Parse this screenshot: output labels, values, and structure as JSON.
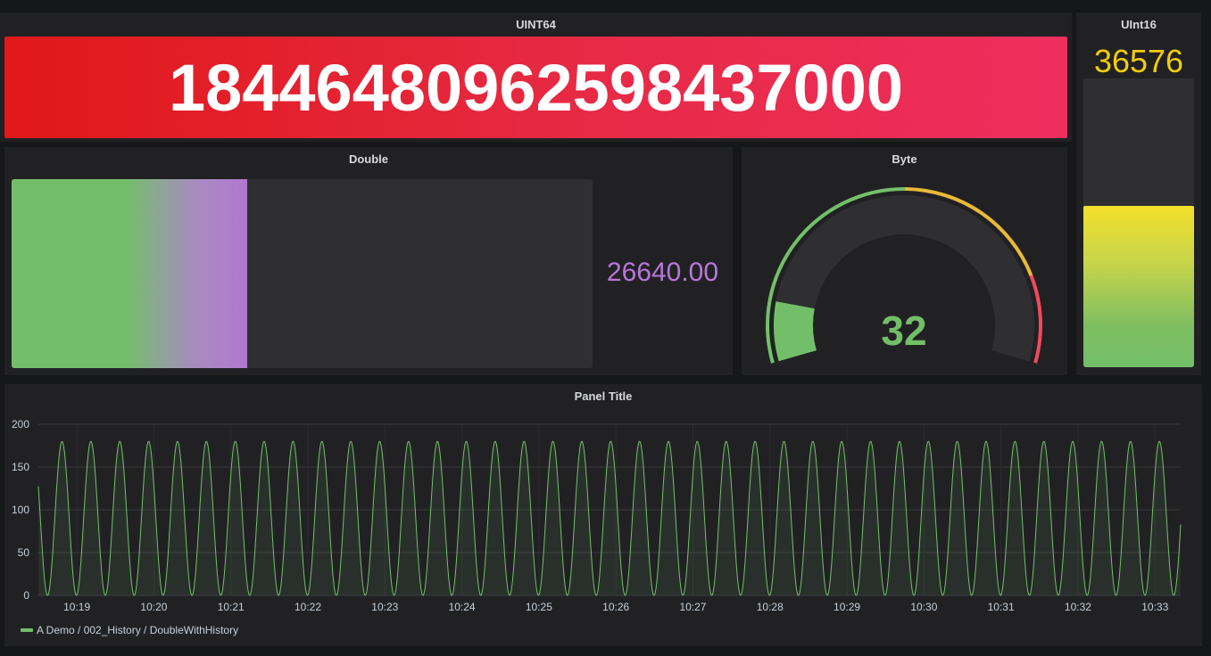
{
  "panels": {
    "uint64": {
      "title": "UINT64",
      "value": "18446480962598437000"
    },
    "uint16": {
      "title": "UInt16",
      "value": "36576",
      "value_color": "#f2cc0c",
      "fill_fraction": 0.56
    },
    "double": {
      "title": "Double",
      "value": "26640.00",
      "value_color": "#b877d9",
      "fill_fraction": 0.406
    },
    "byte": {
      "title": "Byte",
      "value": "32",
      "value_color": "#73bf69",
      "min": 0,
      "max": 255,
      "thresholds": [
        {
          "from": 0,
          "to": 128,
          "color": "#73bf69"
        },
        {
          "from": 128,
          "to": 210,
          "color": "#eab839"
        },
        {
          "from": 210,
          "to": 255,
          "color": "#f2495c"
        }
      ]
    },
    "timeseries": {
      "title": "Panel Title",
      "legend": "A Demo / 002_History / DoubleWithHistory"
    }
  },
  "chart_data": {
    "type": "line",
    "title": "Panel Title",
    "xlabel": "",
    "ylabel": "",
    "ylim": [
      0,
      200
    ],
    "y_ticks": [
      0,
      50,
      100,
      150,
      200
    ],
    "x_ticks": [
      "10:19",
      "10:20",
      "10:21",
      "10:22",
      "10:23",
      "10:24",
      "10:25",
      "10:26",
      "10:27",
      "10:28",
      "10:29",
      "10:30",
      "10:31",
      "10:32",
      "10:33"
    ],
    "grid": true,
    "legend_placement": "bottom-left",
    "series": [
      {
        "name": "A Demo / 002_History / DoubleWithHistory",
        "color": "#73bf69",
        "waveform": "periodic",
        "min": 0,
        "max": 180,
        "period_seconds": 22.5
      }
    ],
    "x_range": [
      "10:18:30",
      "10:33:20"
    ]
  }
}
